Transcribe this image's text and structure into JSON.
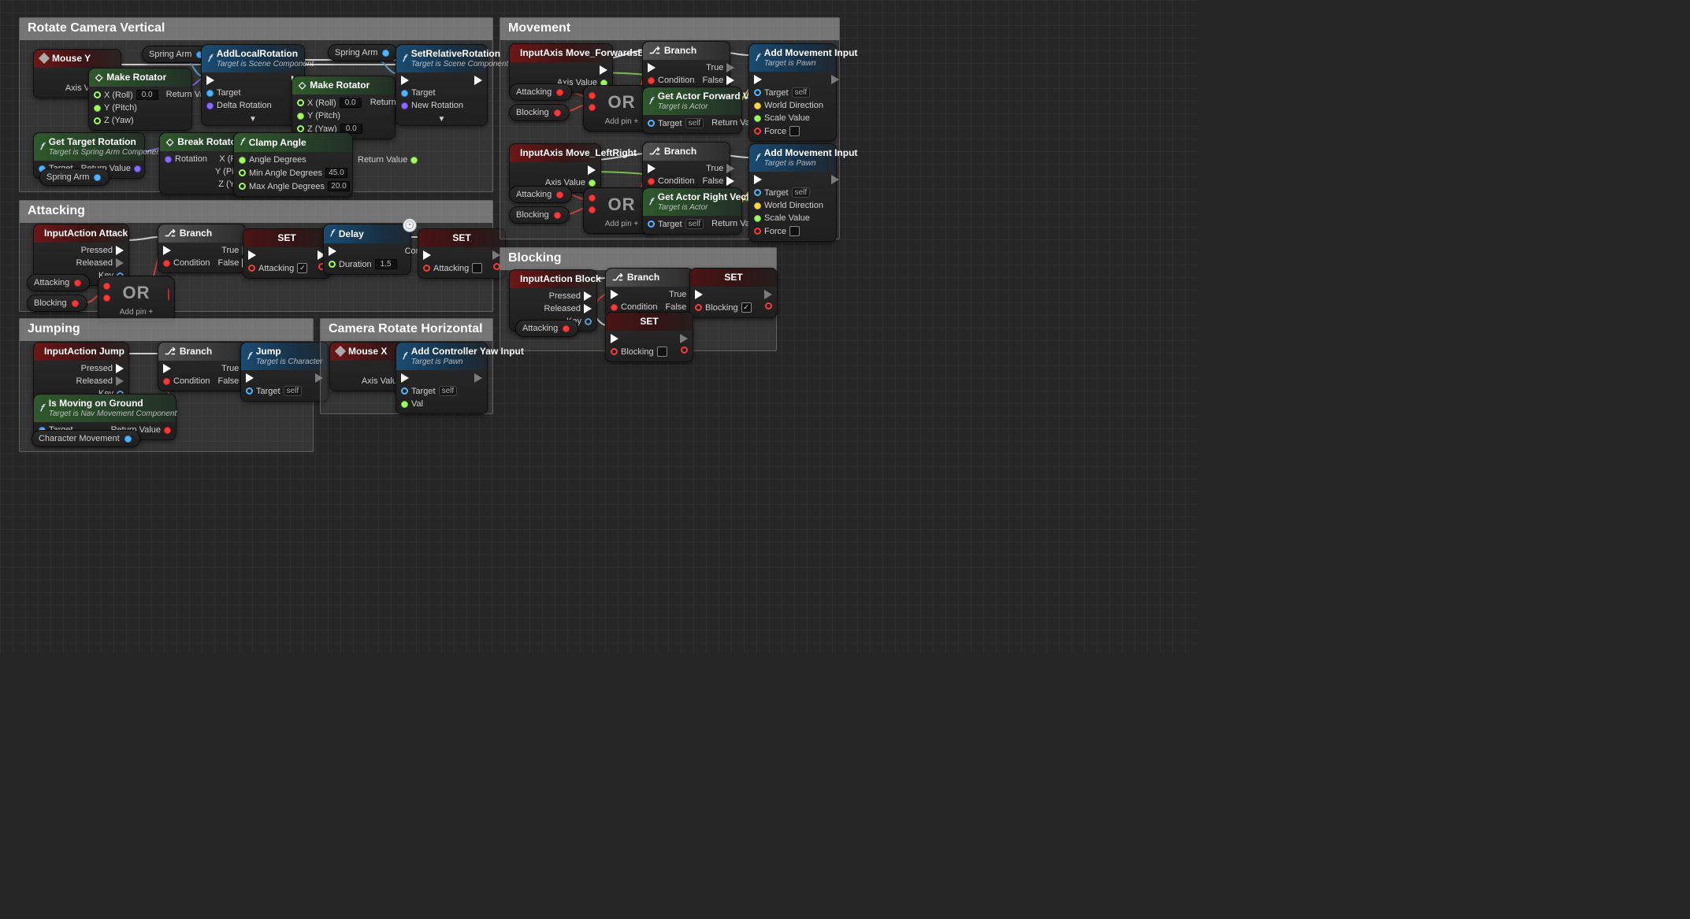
{
  "self": "self",
  "comments": {
    "rotateCam": "Rotate Camera Vertical",
    "attacking": "Attacking",
    "jumping": "Jumping",
    "camHoriz": "Camera Rotate Horizontal",
    "movement": "Movement",
    "blocking": "Blocking"
  },
  "pills": {
    "springArm": "Spring Arm",
    "attacking": "Attacking",
    "blocking": "Blocking",
    "charMove": "Character Movement"
  },
  "labels": {
    "axisValue": "Axis Value",
    "pressed": "Pressed",
    "released": "Released",
    "key": "Key",
    "condition": "Condition",
    "true": "True",
    "false": "False",
    "target": "Target",
    "returnValue": "Return Value",
    "deltaRotation": "Delta Rotation",
    "newRotation": "New Rotation",
    "xRoll": "X (Roll)",
    "yPitch": "Y (Pitch)",
    "zYaw": "Z (Yaw)",
    "rotation": "Rotation",
    "angleDegrees": "Angle Degrees",
    "minAngle": "Min Angle Degrees",
    "maxAngle": "Max Angle Degrees",
    "worldDir": "World Direction",
    "scaleValue": "Scale Value",
    "force": "Force",
    "duration": "Duration",
    "completed": "Completed",
    "val": "Val",
    "addPin": "Add pin  +",
    "or": "OR"
  },
  "nodes": {
    "mouseY": {
      "title": "Mouse Y"
    },
    "mouseX": {
      "title": "Mouse X"
    },
    "makeRot": {
      "title": "Make Rotator"
    },
    "breakRot": {
      "title": "Break Rotator"
    },
    "clampAngle": {
      "title": "Clamp Angle"
    },
    "addLocalRot": {
      "title": "AddLocalRotation",
      "sub": "Target is Scene Component"
    },
    "setRelRot": {
      "title": "SetRelativeRotation",
      "sub": "Target is Scene Component"
    },
    "getTargetRot": {
      "title": "Get Target Rotation",
      "sub": "Target is Spring Arm Component"
    },
    "branch": {
      "title": "Branch"
    },
    "inputAttack": {
      "title": "InputAction Attack"
    },
    "inputJump": {
      "title": "InputAction Jump"
    },
    "inputBlock": {
      "title": "InputAction Block"
    },
    "inputFwd": {
      "title": "InputAxis Move_ForwardsBack"
    },
    "inputLR": {
      "title": "InputAxis Move_LeftRight"
    },
    "set": {
      "title": "SET"
    },
    "delay": {
      "title": "Delay"
    },
    "jump": {
      "title": "Jump",
      "sub": "Target is Character"
    },
    "isMoveGround": {
      "title": "Is Moving on Ground",
      "sub": "Target is Nav Movement Component"
    },
    "addCtrlYaw": {
      "title": "Add Controller Yaw Input",
      "sub": "Target is Pawn"
    },
    "addMoveInput": {
      "title": "Add Movement Input",
      "sub": "Target is Pawn"
    },
    "getFwdVec": {
      "title": "Get Actor Forward Vector",
      "sub": "Target is Actor"
    },
    "getRightVec": {
      "title": "Get Actor Right Vector",
      "sub": "Target is Actor"
    }
  },
  "values": {
    "zero": "0.0",
    "minAngle": "45.0",
    "maxAngle": "20.0",
    "delayDuration": "1.5"
  },
  "setVars": {
    "attacking": "Attacking",
    "blocking": "Blocking"
  }
}
